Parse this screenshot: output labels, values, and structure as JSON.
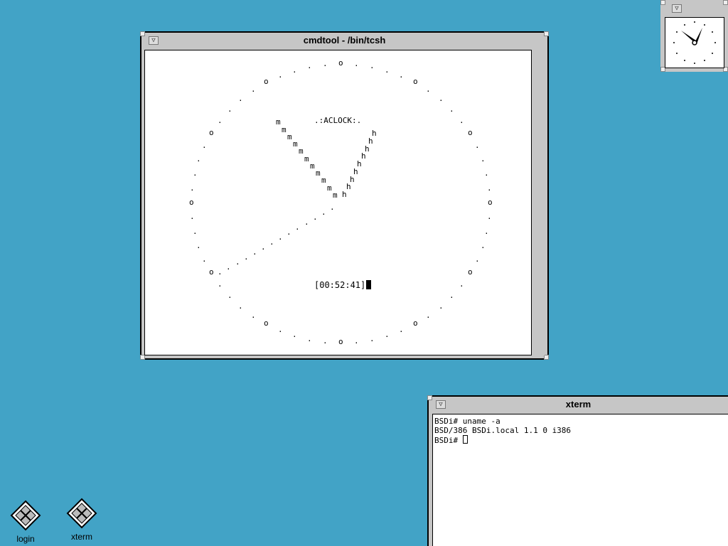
{
  "windows": {
    "cmdtool": {
      "title": "cmdtool - /bin/tcsh",
      "clock_label": ".:ACLOCK:.",
      "time_display": "[00:52:41]"
    },
    "xterm": {
      "title": "xterm",
      "lines": [
        "BSDi# uname -a",
        "BSD/386 BSDi.local 1.1 0 i386",
        "BSDi# "
      ]
    },
    "clock": {
      "hour_hand_icon": "clock-hour-hand",
      "minute_hand_icon": "clock-minute-hand"
    }
  },
  "desktop_icons": [
    {
      "label": "login",
      "icon": "login-icon"
    },
    {
      "label": "xterm",
      "icon": "xterm-icon"
    }
  ],
  "colors": {
    "desktop": "#42a3c6",
    "window_frame": "#c6c6c6"
  }
}
